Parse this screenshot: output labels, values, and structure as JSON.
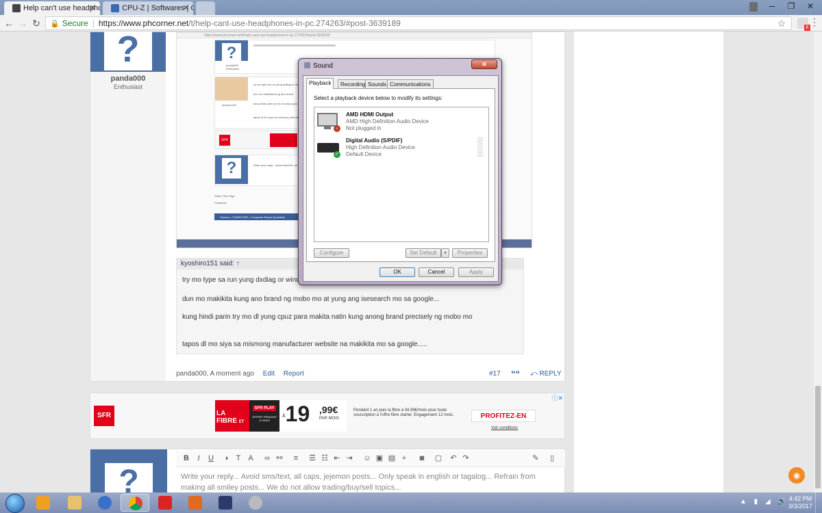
{
  "browser": {
    "tabs": [
      {
        "title": "Help can't use headphon",
        "active": true
      },
      {
        "title": "CPU-Z | Softwares | CPUI",
        "active": false
      }
    ],
    "user_chip": "",
    "address": {
      "secure_label": "Secure",
      "domain": "https://www.phcorner.net",
      "path": "/t/help-cant-use-headphones-in-pc.274263/#post-3639189"
    },
    "extension_badge": "6"
  },
  "post": {
    "user": {
      "name": "panda000",
      "title": "Enthusiast"
    },
    "embedded_screenshot": {
      "mini_address": "https://www.phcorner.net/t/help-cant-use-headphones-in-pc.274263/#post-3639189",
      "mini_user": "panda000",
      "mini_user_title": "Enthusiast",
      "mini_user2": "kyoshiro151",
      "mini_text_1": "try mo type sa run yung dxdiag or windows",
      "mini_text_2": "dun mo makikita kung ano brand",
      "mini_text_3": "kung hindi parin try mo dl yung cpuz",
      "mini_text_4": "tapos dl mo siya sa mismong manufacturer",
      "mini_editor": "Write your reply... Avoid sms/text, all caps...",
      "mini_share": "Share This Page",
      "mini_facebook": "Facebook",
      "mini_breadcrumb": "Forums > COMPUTER > Computer Repair Questions"
    },
    "quote": {
      "header": "kyoshiro151 said: ↑",
      "lines": [
        "try mo type sa run yung dxdiag or windows k",
        "dun mo makikita kung ano brand ng mobo mo at yung ang isesearch mo sa google...",
        "kung hindi parin try mo dl yung cpuz para makita natin kung anong brand precisely ng mobo mo",
        "tapos dl mo siya sa mismong manufacturer website na makikita mo sa google....."
      ]
    },
    "meta": {
      "author_time": "panda000, A moment ago",
      "edit": "Edit",
      "report": "Report",
      "number": "#17",
      "quote_icon": "““",
      "reply": "REPLY"
    }
  },
  "ad": {
    "sfr": "SFR",
    "la": "LA",
    "fibre": "FIBRE",
    "et": "ET",
    "sfr_play": "SFR PLAY",
    "play_small": "OFFERT PENDANT 12 MOIS",
    "a": "À",
    "price_int": "19",
    "price_dec": ",99€",
    "per_month": "PAR MOIS",
    "copy": "Pendant 1 an puis la fibre à 34,99€/mois pour toute souscription à l'offre fibre starter. Engagement 12 mois.",
    "cta": "PROFITEZ-EN",
    "conditions": "Voir conditions"
  },
  "reply_editor": {
    "placeholder": "Write your reply... Avoid sms/text, all caps, jejemon posts... Only speak in english or tagalog... Refrain from making all smiley posts... We do not allow trading/buy/sell topics..."
  },
  "sound_dialog": {
    "title": "Sound",
    "tabs": [
      "Playback",
      "Recording",
      "Sounds",
      "Communications"
    ],
    "instruction": "Select a playback device below to modify its settings:",
    "devices": [
      {
        "name": "AMD HDMI Output",
        "driver": "AMD High Definition Audio Device",
        "status": "Not plugged in"
      },
      {
        "name": "Digital Audio (S/PDIF)",
        "driver": "High Definition Audio Device",
        "status": "Default Device"
      }
    ],
    "buttons": {
      "configure": "Configure",
      "set_default": "Set Default",
      "properties": "Properties",
      "ok": "OK",
      "cancel": "Cancel",
      "apply": "Apply"
    }
  },
  "taskbar": {
    "time": "4:42 PM",
    "date": "3/3/2017"
  },
  "colors": {
    "accent": "#4a6fa5",
    "sfr_red": "#e2001a",
    "link": "#2a5a9a"
  }
}
